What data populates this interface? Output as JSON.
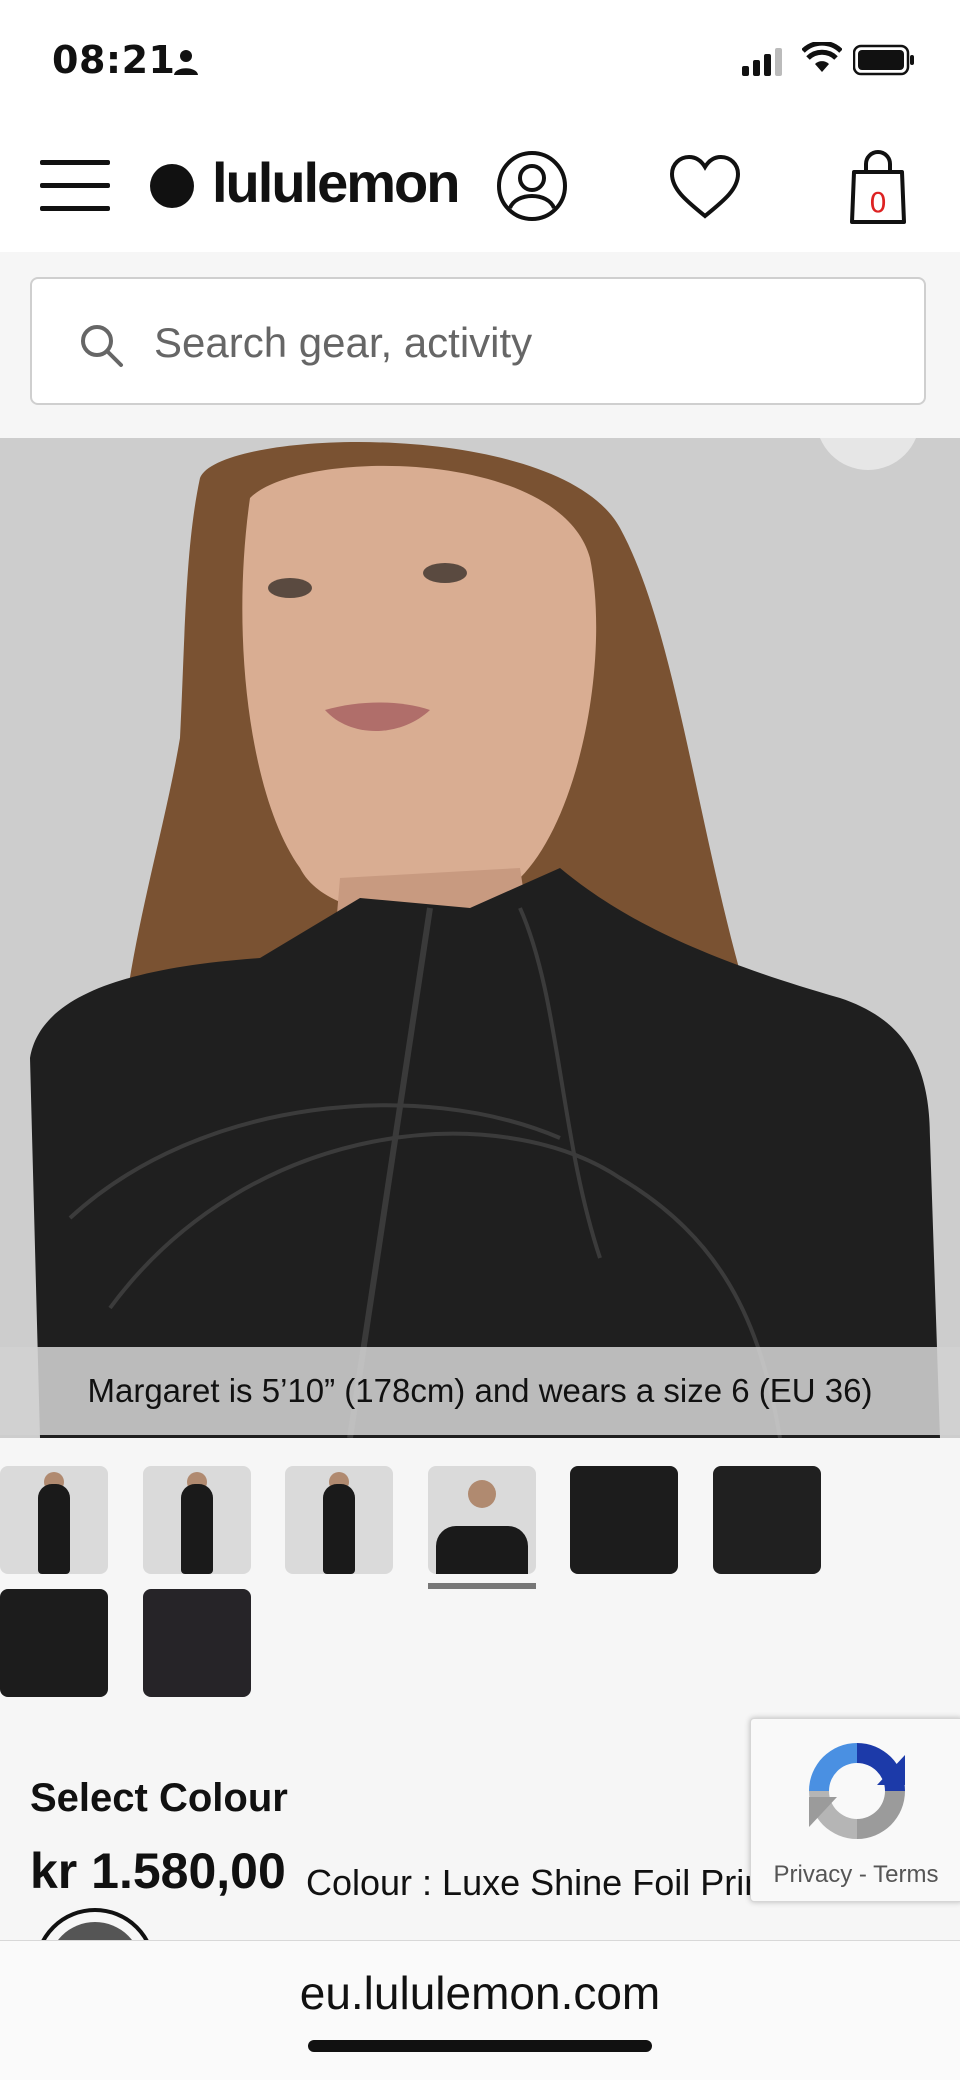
{
  "status_bar": {
    "time": "08:21"
  },
  "header": {
    "brand": "lululemon",
    "cart_count": "0"
  },
  "search": {
    "placeholder": "Search gear, activity"
  },
  "hero": {
    "caption": "Margaret is 5’10” (178cm) and wears a size 6 (EU 36)"
  },
  "thumbnails": {
    "count": 8,
    "selected_index": 3
  },
  "product": {
    "select_colour_label": "Select Colour",
    "price": "kr 1.580,00",
    "colour_label": "Colour : Luxe Shine Foil Print"
  },
  "recaptcha": {
    "privacy": "Privacy",
    "separator": "-",
    "terms": "Terms"
  },
  "browser": {
    "url": "eu.lululemon.com"
  },
  "colors": {
    "accent": "#d22222",
    "text": "#111111",
    "background": "#f6f6f6"
  }
}
